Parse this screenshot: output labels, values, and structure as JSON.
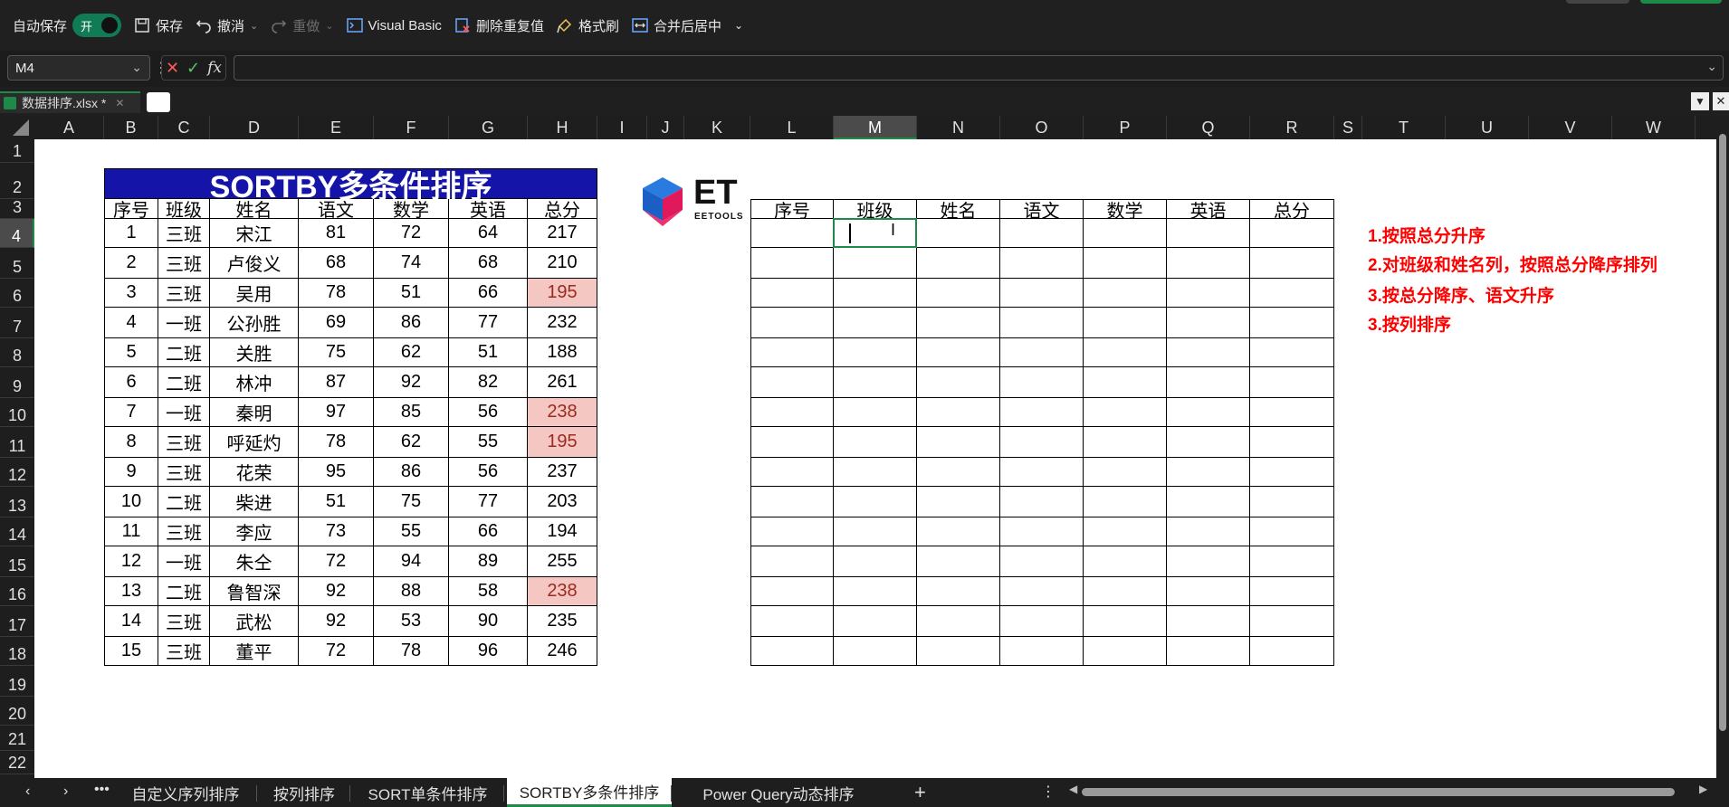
{
  "toolbar": {
    "autosave_label": "自动保存",
    "autosave_state": "开",
    "save": "保存",
    "undo": "撤消",
    "redo": "重做",
    "vb": "Visual Basic",
    "dedupe": "删除重复值",
    "format_painter": "格式刷",
    "merge_center": "合并后居中"
  },
  "formula_bar": {
    "name_box": "M4",
    "formula": ""
  },
  "file_tab": {
    "name": "数据排序.xlsx *"
  },
  "columns": [
    "A",
    "B",
    "C",
    "D",
    "E",
    "F",
    "G",
    "H",
    "I",
    "J",
    "K",
    "L",
    "M",
    "N",
    "O",
    "P",
    "Q",
    "R",
    "S",
    "T",
    "U",
    "V",
    "W"
  ],
  "selected_column": "M",
  "rows": [
    "1",
    "2",
    "3",
    "4",
    "5",
    "6",
    "7",
    "8",
    "9",
    "10",
    "11",
    "12",
    "13",
    "14",
    "15",
    "16",
    "17",
    "18",
    "19",
    "20",
    "21",
    "22"
  ],
  "selected_row": "4",
  "title": "SORTBY多条件排序",
  "headers": [
    "序号",
    "班级",
    "姓名",
    "语文",
    "数学",
    "英语",
    "总分"
  ],
  "data": [
    [
      "1",
      "三班",
      "宋江",
      "81",
      "72",
      "64",
      "217"
    ],
    [
      "2",
      "三班",
      "卢俊义",
      "68",
      "74",
      "68",
      "210"
    ],
    [
      "3",
      "三班",
      "吴用",
      "78",
      "51",
      "66",
      "195"
    ],
    [
      "4",
      "一班",
      "公孙胜",
      "69",
      "86",
      "77",
      "232"
    ],
    [
      "5",
      "二班",
      "关胜",
      "75",
      "62",
      "51",
      "188"
    ],
    [
      "6",
      "二班",
      "林冲",
      "87",
      "92",
      "82",
      "261"
    ],
    [
      "7",
      "一班",
      "秦明",
      "97",
      "85",
      "56",
      "238"
    ],
    [
      "8",
      "三班",
      "呼延灼",
      "78",
      "62",
      "55",
      "195"
    ],
    [
      "9",
      "三班",
      "花荣",
      "95",
      "86",
      "56",
      "237"
    ],
    [
      "10",
      "二班",
      "柴进",
      "51",
      "75",
      "77",
      "203"
    ],
    [
      "11",
      "三班",
      "李应",
      "73",
      "55",
      "66",
      "194"
    ],
    [
      "12",
      "一班",
      "朱仝",
      "72",
      "94",
      "89",
      "255"
    ],
    [
      "13",
      "二班",
      "鲁智深",
      "92",
      "88",
      "58",
      "238"
    ],
    [
      "14",
      "三班",
      "武松",
      "92",
      "53",
      "90",
      "235"
    ],
    [
      "15",
      "三班",
      "董平",
      "72",
      "78",
      "96",
      "246"
    ]
  ],
  "highlighted_rows": [
    2,
    6,
    7,
    12
  ],
  "highlight_color": "#f4c7c3",
  "logo": {
    "letters": "ET",
    "sub": "EETOOLS"
  },
  "notes": [
    "1.按照总分升序",
    "2.对班级和姓名列，按照总分降序排列",
    "3.按总分降序、语文升序",
    "3.按列排序"
  ],
  "sheet_tabs": [
    "自定义序列排序",
    "按列排序",
    "SORT单条件排序",
    "SORTBY多条件排序",
    "Power Query动态排序"
  ],
  "active_sheet": "SORTBY多条件排序",
  "accent": "#1e8a4a",
  "title_bg": "#1414a8",
  "note_color": "#ff0000"
}
